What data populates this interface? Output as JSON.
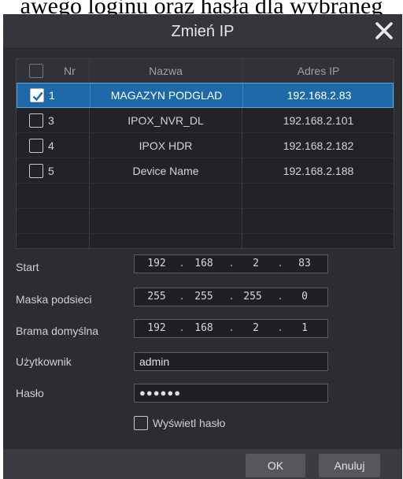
{
  "background_text": "awego loginu oraz hasła dla wybraneg",
  "dialog": {
    "title": "Zmień IP",
    "close_icon": "close-icon"
  },
  "table": {
    "headers": [
      "Nr",
      "Nazwa",
      "Adres IP"
    ],
    "rows": [
      {
        "nr": "1",
        "name": "MAGAZYN PODGLAD",
        "ip": "192.168.2.83",
        "checked": true,
        "selected": true
      },
      {
        "nr": "3",
        "name": "IPOX_NVR_DL",
        "ip": "192.168.2.101",
        "checked": false,
        "selected": false
      },
      {
        "nr": "4",
        "name": "IPOX HDR",
        "ip": "192.168.2.182",
        "checked": false,
        "selected": false
      },
      {
        "nr": "5",
        "name": "Device Name",
        "ip": "192.168.2.188",
        "checked": false,
        "selected": false
      }
    ]
  },
  "form": {
    "start": {
      "label": "Start",
      "octets": [
        "192",
        "168",
        "2",
        "83"
      ]
    },
    "mask": {
      "label": "Maska podsieci",
      "octets": [
        "255",
        "255",
        "255",
        "0"
      ]
    },
    "gateway": {
      "label": "Brama domyślna",
      "octets": [
        "192",
        "168",
        "2",
        "1"
      ]
    },
    "user": {
      "label": "Użytkownik",
      "value": "admin"
    },
    "password": {
      "label": "Hasło",
      "value": "●●●●●●"
    },
    "show_password": {
      "label": "Wyświetl hasło",
      "checked": false
    }
  },
  "buttons": {
    "ok": "OK",
    "cancel": "Anuluj"
  },
  "colors": {
    "selection": "#1e6aa8",
    "dialog_bg": "#2b2d31",
    "accent_border": "#5fa6db"
  }
}
